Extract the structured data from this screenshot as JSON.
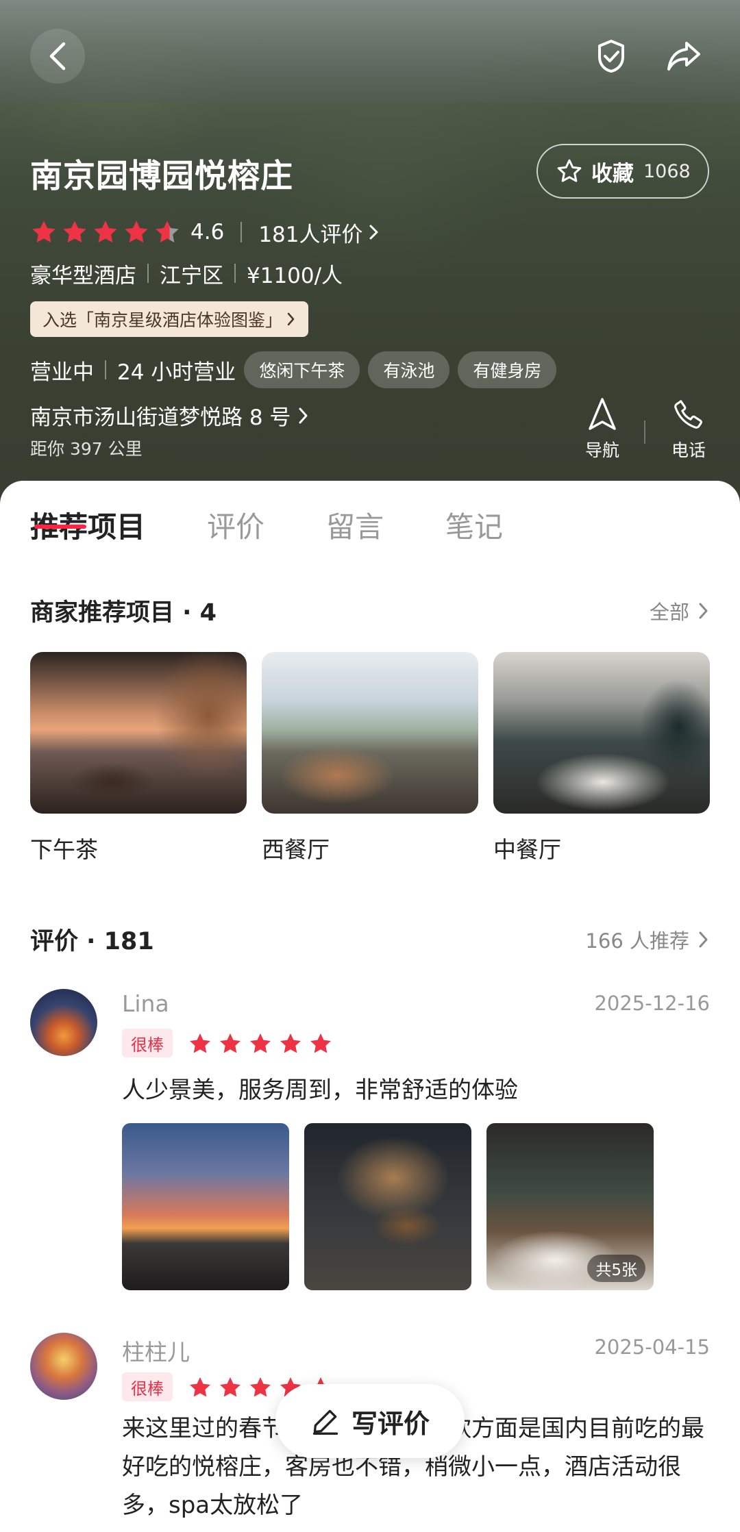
{
  "header": {
    "back_icon": "chevron-left-icon",
    "verify_icon": "check-badge-icon",
    "share_icon": "share-arrow-icon"
  },
  "hotel": {
    "name": "南京园博园悦榕庄",
    "favorite_label": "收藏",
    "favorite_count": "1068",
    "rating": "4.6",
    "rating_stars": 4.6,
    "review_count_label": "181人评价",
    "category": "豪华型酒店",
    "district": "江宁区",
    "price": "¥1100/人",
    "award": "入选「南京星级酒店体验图鉴」",
    "status": "营业中",
    "hours": "24 小时营业",
    "features": [
      "悠闲下午茶",
      "有泳池",
      "有健身房"
    ],
    "address": "南京市汤山街道梦悦路 8 号",
    "distance": "距你 397 公里",
    "navigate_label": "导航",
    "call_label": "电话"
  },
  "tabs": [
    {
      "label": "推荐项目",
      "active": true
    },
    {
      "label": "评价",
      "active": false
    },
    {
      "label": "留言",
      "active": false
    },
    {
      "label": "笔记",
      "active": false
    }
  ],
  "recommend": {
    "title": "商家推荐项目 · 4",
    "more_label": "全部",
    "items": [
      {
        "name": "下午茶"
      },
      {
        "name": "西餐厅"
      },
      {
        "name": "中餐厅"
      }
    ]
  },
  "reviews_section": {
    "title": "评价 · 181",
    "recommend_label": "166 人推荐"
  },
  "reviews": [
    {
      "user": "Lina",
      "date": "2025-12-16",
      "tag": "很棒",
      "stars": 5,
      "text": "人少景美，服务周到，非常舒适的体验",
      "photo_count": "共5张"
    },
    {
      "user": "柱柱儿",
      "date": "2025-04-15",
      "tag": "很棒",
      "stars": 5,
      "text": "来这里过的春节，太舒服了，餐饮方面是国内目前吃的最好吃的悦榕庄，客房也不错，稍微小一点，酒店活动很多，spa太放松了"
    }
  ],
  "write_review": {
    "label": "写评价",
    "icon": "pencil-icon"
  },
  "colors": {
    "accent": "#ff2442",
    "star": "#ee3344",
    "tag_bg": "#fde9ec",
    "award_bg": "#f4e7d7"
  }
}
